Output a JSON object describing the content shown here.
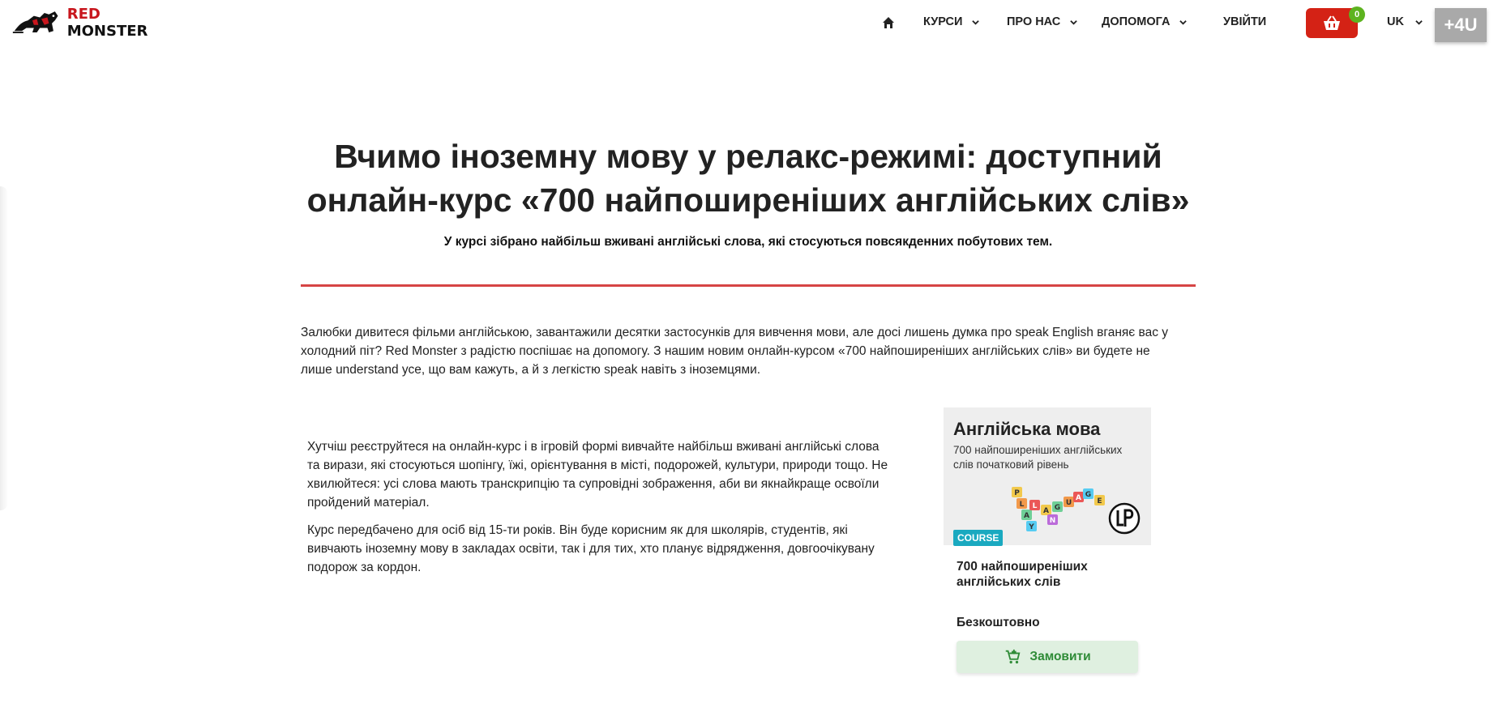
{
  "header": {
    "logo_text_red": "RED",
    "logo_text_black": "MONSTER",
    "nav": {
      "courses": "КУРСИ",
      "about": "ПРО НАС",
      "help": "ДОПОМОГА",
      "login": "УВІЙТИ"
    },
    "cart_count": "0",
    "language": "UK",
    "plus4u": "+4U",
    "colors": {
      "cart": "#d42215",
      "badge": "#5db31f"
    }
  },
  "article": {
    "title": "Вчимо іноземну мову у релакс-режимі: доступний онлайн-курс «700 найпоширеніших англійських слів»",
    "subtitle": "У курсі зібрано найбільш вживані англійські слова, які стосуються повсякденних побутових тем.",
    "intro": "Залюбки дивитеся фільми англійською, завантажили десятки застосунків для вивчення мови, але досі лишень думка про speak English вганяє вас у холодний піт? Red Monster з радістю поспішає на допомогу. З нашим новим онлайн-курсом «700 найпоширеніших англійських слів» ви будете не лише understand усе, що вам кажуть, а й з легкістю speak навіть з іноземцями.",
    "paragraph1": "Хутчіш реєструйтеся на онлайн-курс і в ігровій формі вивчайте найбільш вживані англійські слова та вирази, які стосуються шопінгу, їжі, орієнтування в місті, подорожей, культури, природи тощо. Не хвилюйтеся: усі слова мають транскрипцію та супровідні зображення, аби ви якнайкраще освоїли пройдений матеріал.",
    "paragraph2": "Курс передбачено для осіб від 15-ти років. Він буде корисним як для школярів, студентів, які вивчають іноземну мову в закладах освіти, так і для тих, хто планує відрядження, довгоочікувану подорож за кордон."
  },
  "course_card": {
    "image_title": "Англійська мова",
    "image_subtitle": "700 найпоширеніших англійських слів початковий рівень",
    "badge": "COURSE",
    "name": "700 найпоширеніших англійських слів",
    "price": "Безкоштовно",
    "order_label": "Замовити",
    "tiles": [
      "P",
      "L",
      "A",
      "Y",
      "L",
      "A",
      "N",
      "G",
      "U",
      "A",
      "G",
      "E"
    ]
  }
}
